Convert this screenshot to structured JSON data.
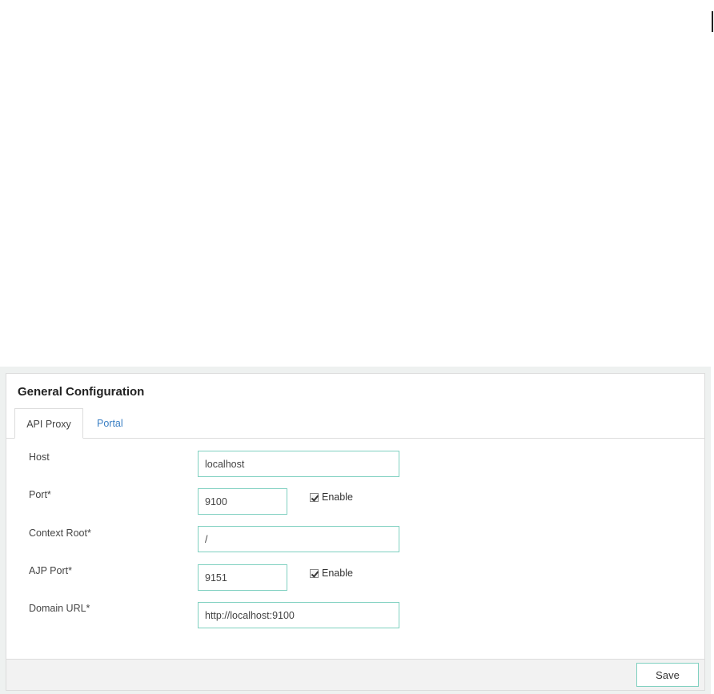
{
  "panel": {
    "title": "General Configuration"
  },
  "tabs": [
    {
      "label": "API Proxy",
      "active": true
    },
    {
      "label": "Portal",
      "active": false
    }
  ],
  "form": {
    "host": {
      "label": "Host",
      "value": "localhost"
    },
    "port": {
      "label": "Port*",
      "value": "9100",
      "enable_label": "Enable",
      "enabled": true
    },
    "context_root": {
      "label": "Context Root*",
      "value": "/"
    },
    "ajp_port": {
      "label": "AJP Port*",
      "value": "9151",
      "enable_label": "Enable",
      "enabled": true
    },
    "domain_url": {
      "label": "Domain URL*",
      "value": "http://localhost:9100"
    }
  },
  "footer": {
    "save_label": "Save"
  },
  "colors": {
    "accent_border": "#7fd0c0",
    "link": "#3a7fc4"
  }
}
